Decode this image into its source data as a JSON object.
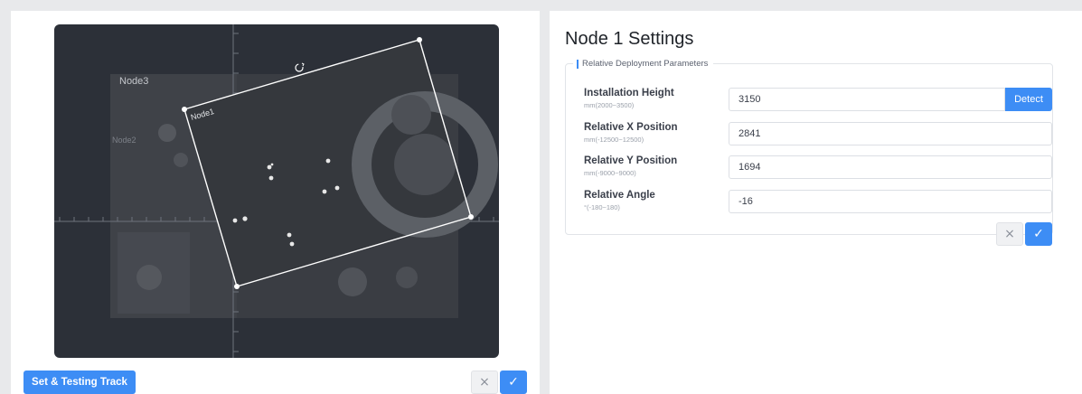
{
  "canvas": {
    "node_labels": [
      "Node3",
      "Node1",
      "Node2"
    ],
    "bg_color": "#2c3038"
  },
  "left_footer": {
    "track_button": "Set & Testing Track",
    "cancel_icon": "×",
    "confirm_icon": "✓"
  },
  "settings": {
    "title": "Node 1 Settings",
    "legend": "Relative Deployment Parameters",
    "fields": [
      {
        "label": "Installation Height",
        "range": "mm(2000~3500)",
        "value": "3150",
        "action": "Detect"
      },
      {
        "label": "Relative X Position",
        "range": "mm(-12500~12500)",
        "value": "2841"
      },
      {
        "label": "Relative Y Position",
        "range": "mm(-9000~9000)",
        "value": "1694"
      },
      {
        "label": "Relative Angle",
        "range": "°(-180~180)",
        "value": "-16"
      }
    ],
    "cancel_icon": "×",
    "confirm_icon": "✓"
  },
  "colors": {
    "primary": "#3d8df5",
    "page_bg": "#e8e9eb"
  }
}
